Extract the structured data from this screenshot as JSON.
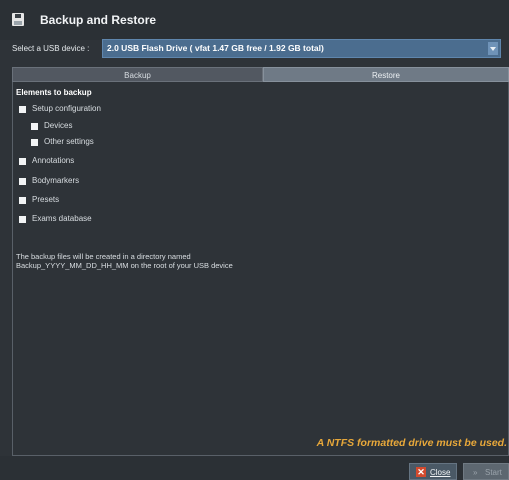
{
  "window": {
    "title": "Backup and Restore"
  },
  "usb": {
    "label": "Select a USB device :",
    "selected": "2.0 USB Flash Drive ( vfat 1.47 GB free / 1.92 GB total)"
  },
  "tabs": [
    {
      "label": "Backup",
      "active": true
    },
    {
      "label": "Restore",
      "active": false
    }
  ],
  "backup": {
    "section_title": "Elements to backup",
    "items": [
      {
        "label": "Setup configuration",
        "checked": true
      },
      {
        "label": "Devices",
        "checked": true
      },
      {
        "label": "Other settings",
        "checked": true
      },
      {
        "label": "Annotations",
        "checked": true
      },
      {
        "label": "Bodymarkers",
        "checked": true
      },
      {
        "label": "Presets",
        "checked": true
      },
      {
        "label": "Exams database",
        "checked": true
      }
    ],
    "info_line1": "The backup files will be created in a directory named",
    "info_line2": "Backup_YYYY_MM_DD_HH_MM on the root of your USB device"
  },
  "warning": "A NTFS formatted drive must be used.",
  "buttons": {
    "close_label": "Close",
    "close_icon": "close-icon",
    "start_label": "Start",
    "start_enabled": false
  },
  "colors": {
    "accent_select": "#4b6d8f",
    "warning": "#e8a83a",
    "close_icon": "#d24a2e"
  }
}
